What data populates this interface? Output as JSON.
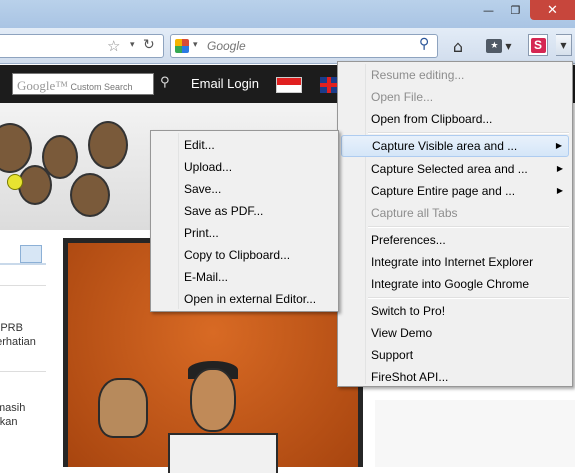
{
  "window": {
    "minimize_glyph": "—",
    "maximize_glyph": "❐",
    "close_glyph": "✕"
  },
  "toolbar": {
    "search_placeholder": "Google",
    "home_icon": "home-icon",
    "bookmarks_icon": "bookmarks-icon",
    "fireshot_letter": "S"
  },
  "site": {
    "search_brand": "Google™",
    "search_label": "Custom Search",
    "email_login": "Email Login"
  },
  "left_col": {
    "line1": "am PRB",
    "line2": "perhatian",
    "line3": "masih",
    "line4": "nyakan"
  },
  "main_menu": {
    "items": [
      {
        "label": "Resume editing...",
        "disabled": true
      },
      {
        "label": "Open File...",
        "disabled": true
      },
      {
        "label": "Open from Clipboard..."
      },
      {
        "label": "Capture Visible area and ...",
        "submenu": true,
        "highlighted": true
      },
      {
        "label": "Capture Selected area and ...",
        "submenu": true
      },
      {
        "label": "Capture Entire page and ...",
        "submenu": true
      },
      {
        "label": "Capture all Tabs",
        "disabled": true
      },
      {
        "label": "Preferences..."
      },
      {
        "label": "Integrate into Internet Explorer"
      },
      {
        "label": "Integrate into Google Chrome"
      },
      {
        "label": "Switch to Pro!"
      },
      {
        "label": "View Demo"
      },
      {
        "label": "Support"
      },
      {
        "label": "FireShot API..."
      }
    ]
  },
  "sub_menu": {
    "items": [
      {
        "label": "Edit..."
      },
      {
        "label": "Upload..."
      },
      {
        "label": "Save..."
      },
      {
        "label": "Save as PDF..."
      },
      {
        "label": "Print..."
      },
      {
        "label": "Copy to Clipboard..."
      },
      {
        "label": "E-Mail..."
      },
      {
        "label": "Open in external Editor..."
      }
    ]
  },
  "colors": {
    "menu_bg": "#f0f0f0",
    "highlight_border": "#aeccf0",
    "fireshot_red": "#d52652",
    "close_red": "#c7463c"
  }
}
